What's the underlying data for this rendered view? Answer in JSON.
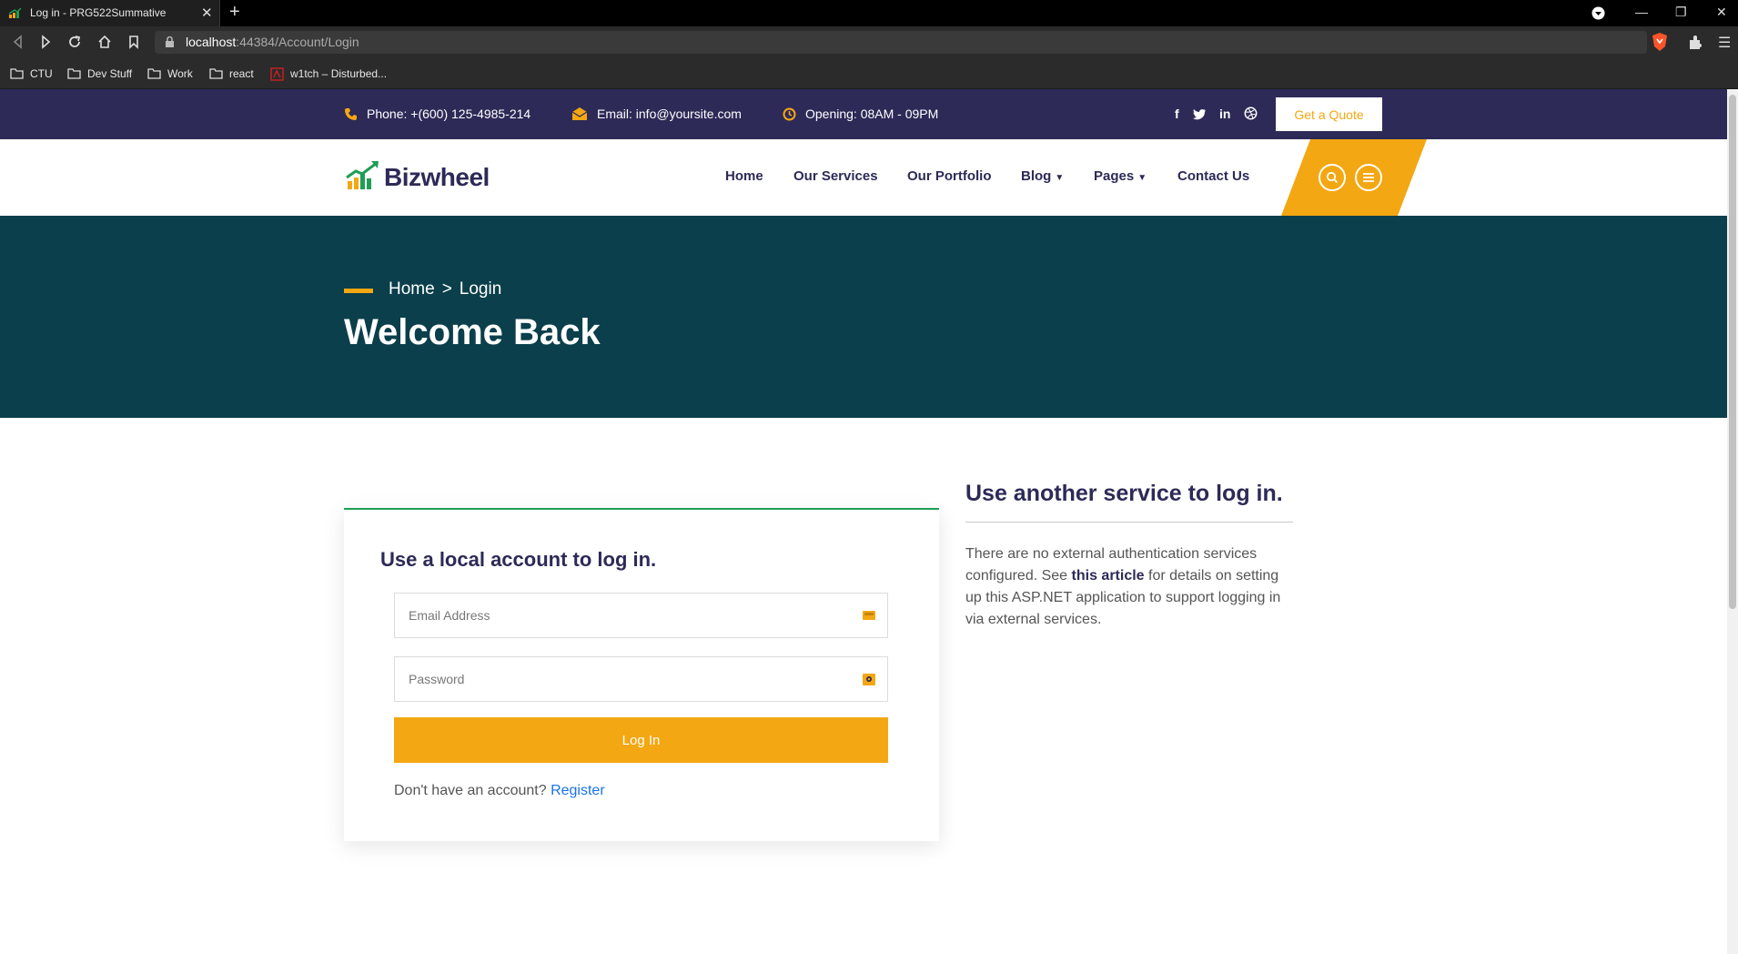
{
  "browser": {
    "tab_title": "Log in - PRG522Summative",
    "url_host": "localhost",
    "url_rest": ":44384/Account/Login",
    "bookmarks": [
      "CTU",
      "Dev Stuff",
      "Work",
      "react",
      "w1tch – Disturbed..."
    ]
  },
  "topbar": {
    "phone": "Phone: +(600) 125-4985-214",
    "email": "Email: info@yoursite.com",
    "opening": "Opening: 08AM - 09PM",
    "quote_button": "Get a Quote"
  },
  "navbar": {
    "logo": "Bizwheel",
    "links": [
      "Home",
      "Our Services",
      "Our Portfolio",
      "Blog",
      "Pages",
      "Contact Us"
    ]
  },
  "hero": {
    "breadcrumb_home": "Home",
    "breadcrumb_sep": ">",
    "breadcrumb_current": "Login",
    "title": "Welcome Back"
  },
  "login": {
    "title": "Use a local account to log in.",
    "email_placeholder": "Email Address",
    "password_placeholder": "Password",
    "button": "Log In",
    "no_account": "Don't have an account?",
    "register": "Register"
  },
  "external": {
    "title": "Use another service to log in.",
    "text_1": "There are no external authentication services configured. See ",
    "link": "this article",
    "text_2": " for details on setting up this ASP.NET application to support logging in via external services."
  },
  "colors": {
    "topbar": "#2d2a57",
    "hero": "#0a3f4b",
    "accent": "#f3a712",
    "card_border": "#1f9d55",
    "link": "#1a73e8"
  },
  "icons": [
    "phone-icon",
    "email-icon",
    "clock-icon",
    "facebook-icon",
    "twitter-icon",
    "linkedin-icon",
    "dribbble-icon",
    "search-icon",
    "menu-icon",
    "key-icon",
    "lock-field-icon"
  ]
}
